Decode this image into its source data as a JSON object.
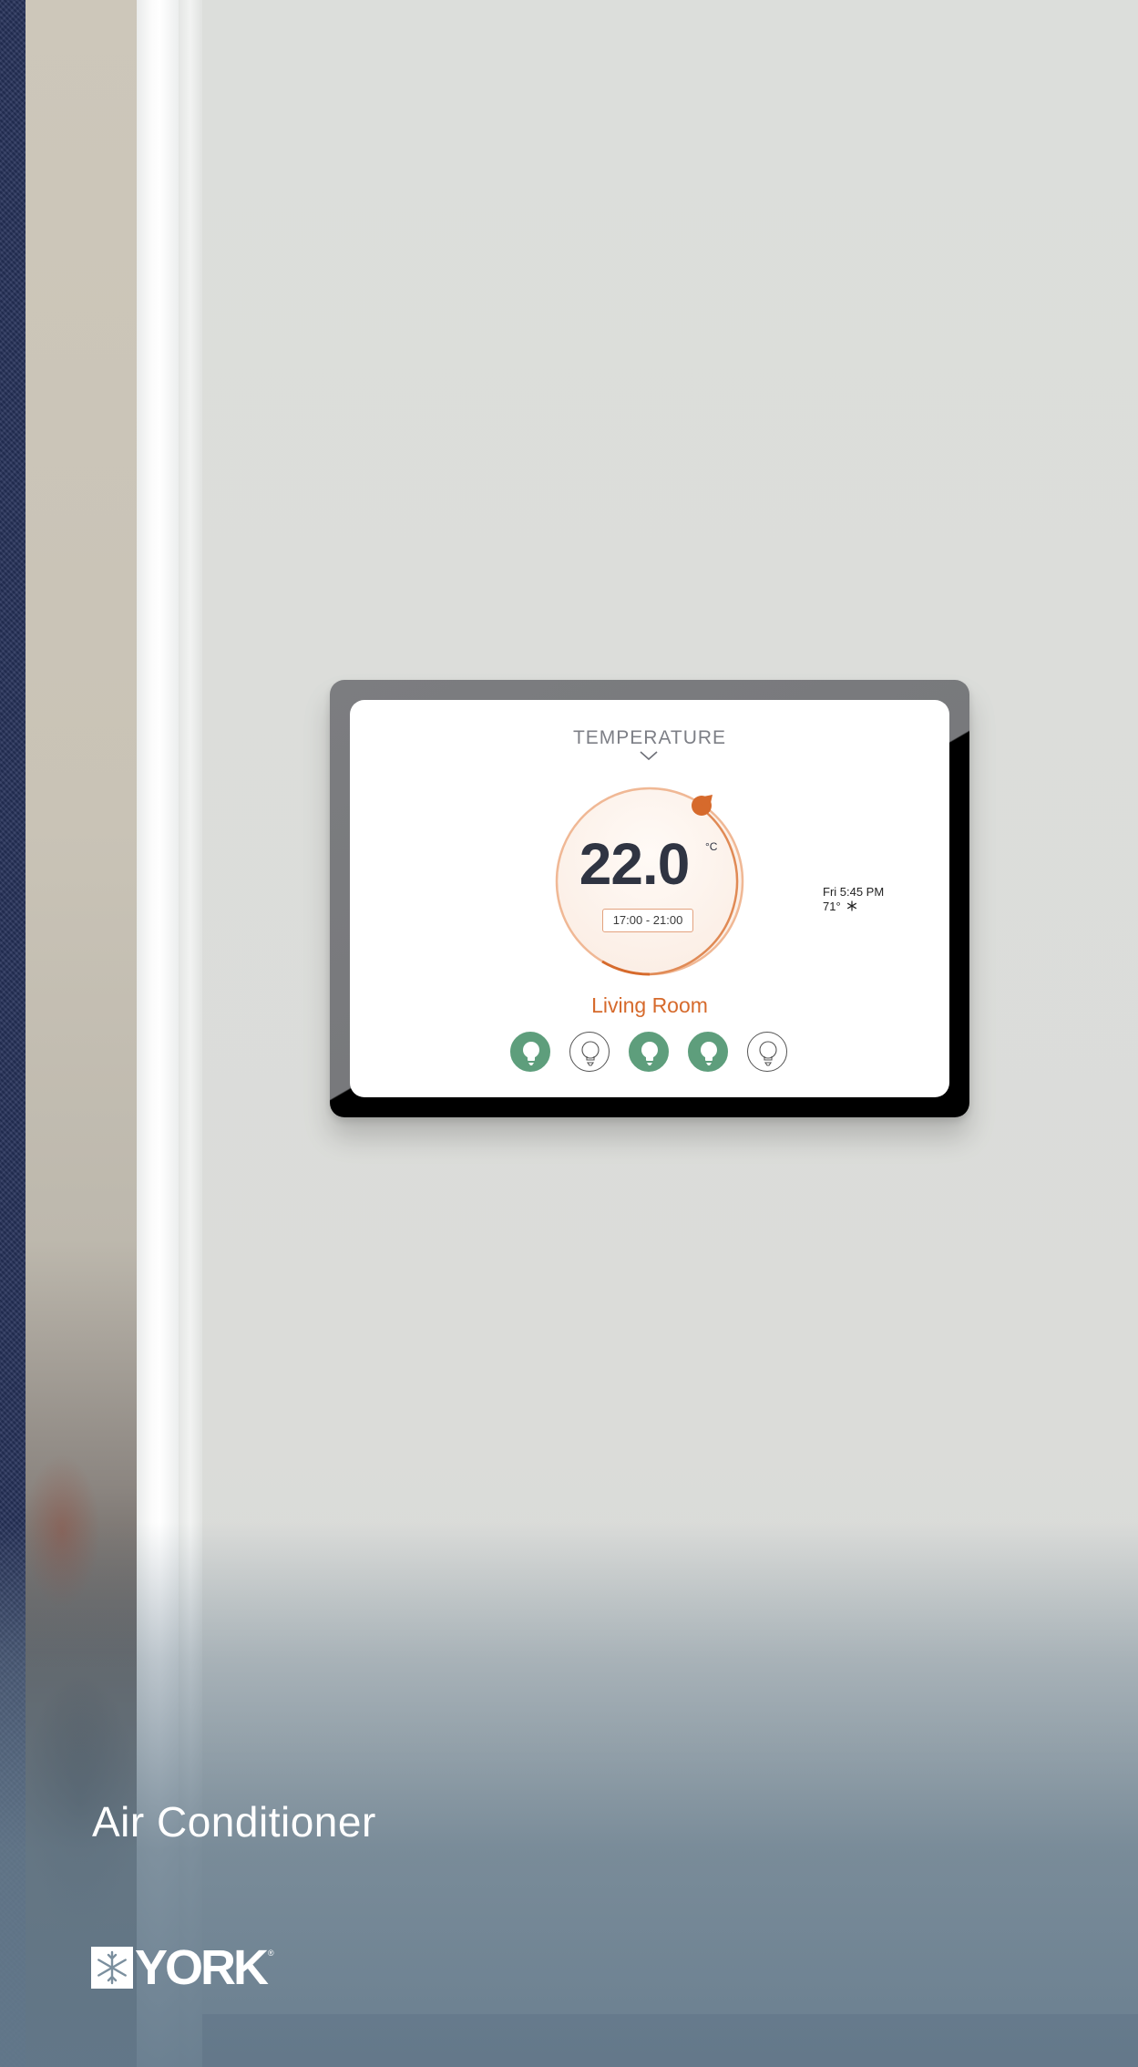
{
  "screen": {
    "title": "TEMPERATURE",
    "temperature": "22.0",
    "unit": "°C",
    "schedule": "17:00 - 21:00",
    "clock_time": "Fri 5:45 PM",
    "outdoor_temp": "71°",
    "room_name": "Living Room",
    "lights": [
      {
        "name": "light-1",
        "state": "on"
      },
      {
        "name": "light-2",
        "state": "off"
      },
      {
        "name": "light-3",
        "state": "on"
      },
      {
        "name": "light-4",
        "state": "on"
      },
      {
        "name": "light-5",
        "state": "off"
      }
    ]
  },
  "product": {
    "caption": "Air Conditioner",
    "brand": "YORK"
  },
  "colors": {
    "accent_orange": "#d66a2c",
    "light_on_green": "#5e9e7c",
    "text_dark": "#2f3442"
  },
  "icons": {
    "chevron": "chevron-down-icon",
    "weather": "snowflake-icon",
    "light": "lightbulb-icon",
    "brand": "york-snowflake-logo"
  }
}
